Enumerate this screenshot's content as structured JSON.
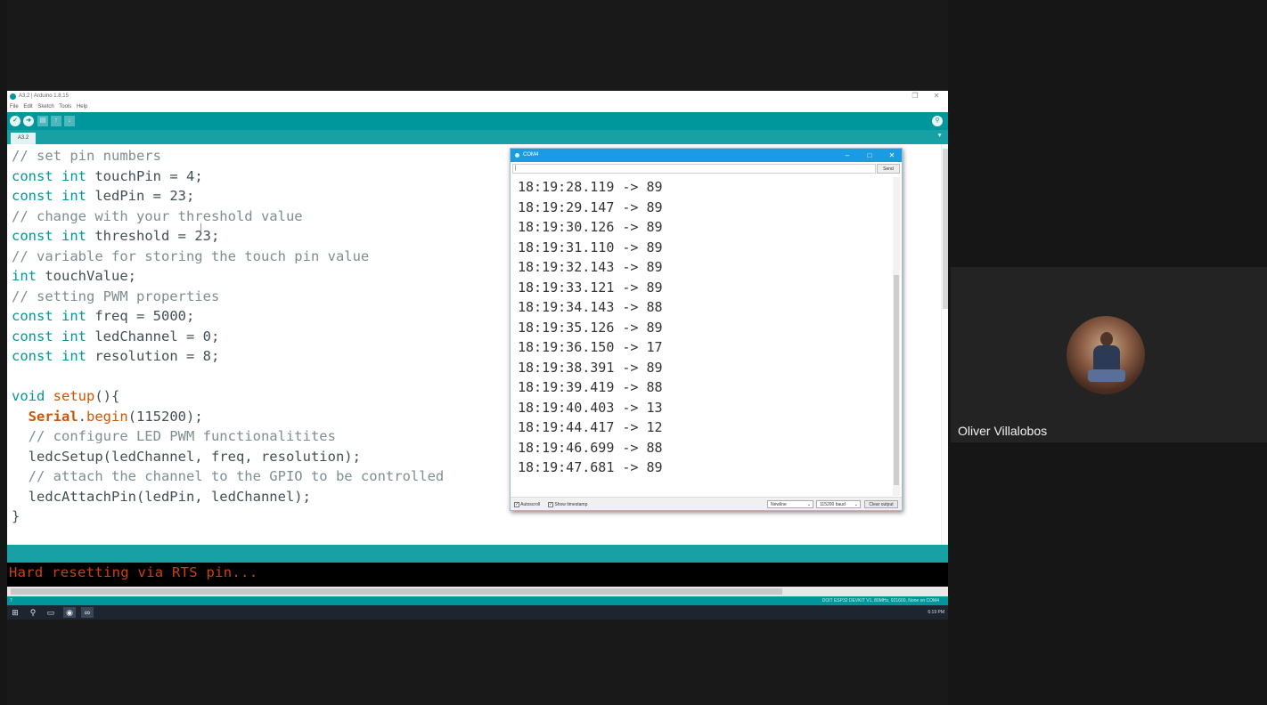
{
  "ide": {
    "window_title": "A3.2 | Arduino 1.8.15",
    "menu": [
      "File",
      "Edit",
      "Sketch",
      "Tools",
      "Help"
    ],
    "toolbar": {
      "verify_icon": "checkmark-icon",
      "upload_icon": "arrow-right-icon",
      "new_icon": "new-file-icon",
      "open_icon": "arrow-up-icon",
      "save_icon": "arrow-down-icon",
      "serial_icon": "magnifier-icon"
    },
    "tab_label": "A3.2",
    "code_lines": [
      [
        {
          "t": "// set pin numbers",
          "c": "comment"
        }
      ],
      [
        {
          "t": "const int",
          "c": "kw"
        },
        {
          "t": " touchPin = 4;",
          "c": "plain"
        }
      ],
      [
        {
          "t": "const int",
          "c": "kw"
        },
        {
          "t": " ledPin = 23;",
          "c": "plain"
        }
      ],
      [
        {
          "t": "// change with your threshold value",
          "c": "comment"
        }
      ],
      [
        {
          "t": "const int",
          "c": "kw"
        },
        {
          "t": " threshold = 23;",
          "c": "plain"
        }
      ],
      [
        {
          "t": "// variable for storing the touch pin value",
          "c": "comment"
        }
      ],
      [
        {
          "t": "int",
          "c": "kw"
        },
        {
          "t": " touchValue;",
          "c": "plain"
        }
      ],
      [
        {
          "t": "// setting PWM properties",
          "c": "comment"
        }
      ],
      [
        {
          "t": "const int",
          "c": "kw"
        },
        {
          "t": " freq = 5000;",
          "c": "plain"
        }
      ],
      [
        {
          "t": "const int",
          "c": "kw"
        },
        {
          "t": " ledChannel = 0;",
          "c": "plain"
        }
      ],
      [
        {
          "t": "const int",
          "c": "kw"
        },
        {
          "t": " resolution = 8;",
          "c": "plain"
        }
      ],
      [
        {
          "t": "",
          "c": "plain"
        }
      ],
      [
        {
          "t": "void",
          "c": "kw"
        },
        {
          "t": " ",
          "c": "plain"
        },
        {
          "t": "setup",
          "c": "fn"
        },
        {
          "t": "(){",
          "c": "plain"
        }
      ],
      [
        {
          "t": "  ",
          "c": "plain"
        },
        {
          "t": "Serial",
          "c": "serial"
        },
        {
          "t": ".",
          "c": "plain"
        },
        {
          "t": "begin",
          "c": "fn"
        },
        {
          "t": "(115200);",
          "c": "plain"
        }
      ],
      [
        {
          "t": "  // configure LED PWM functionalitites",
          "c": "comment"
        }
      ],
      [
        {
          "t": "  ledcSetup(ledChannel, freq, resolution);",
          "c": "plain"
        }
      ],
      [
        {
          "t": "  // attach the channel to the GPIO to be controlled",
          "c": "comment"
        }
      ],
      [
        {
          "t": "  ledcAttachPin(ledPin, ledChannel);",
          "c": "plain"
        }
      ],
      [
        {
          "t": "}",
          "c": "plain"
        }
      ]
    ],
    "console_message": "Hard resetting via RTS pin...",
    "status_line": "7",
    "board_info": "DOIT ESP32 DEVKIT V1, 80MHz, 921600, None on COM4",
    "clock": "6:19 PM"
  },
  "serial_monitor": {
    "title": "COM4",
    "input_value": "|",
    "send_label": "Send",
    "lines": [
      "18:19:28.119 -> 89",
      "18:19:29.147 -> 89",
      "18:19:30.126 -> 89",
      "18:19:31.110 -> 89",
      "18:19:32.143 -> 89",
      "18:19:33.121 -> 89",
      "18:19:34.143 -> 88",
      "18:19:35.126 -> 89",
      "18:19:36.150 -> 17",
      "18:19:38.391 -> 89",
      "18:19:39.419 -> 88",
      "18:19:40.403 -> 13",
      "18:19:44.417 -> 12",
      "18:19:46.699 -> 88",
      "18:19:47.681 -> 89"
    ],
    "autoscroll_label": "Autoscroll",
    "autoscroll_checked": true,
    "timestamp_label": "Show timestamp",
    "timestamp_checked": true,
    "line_ending": "Newline",
    "baud": "115200 baud",
    "clear_label": "Clear output"
  },
  "participant": {
    "name": "Oliver Villalobos"
  }
}
